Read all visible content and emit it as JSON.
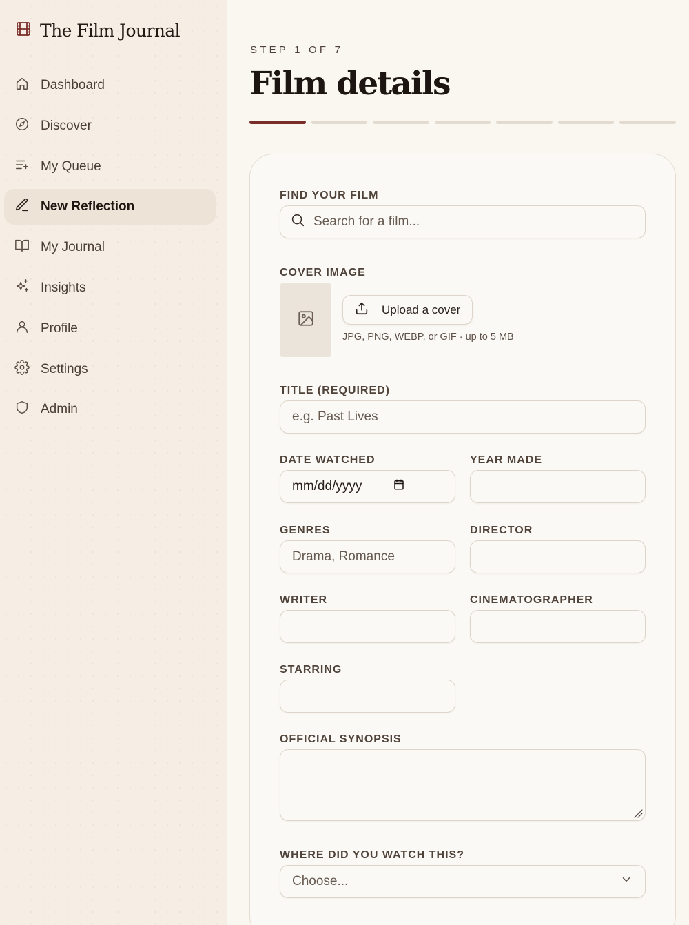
{
  "app": {
    "title": "The Film Journal"
  },
  "sidebar": {
    "items": [
      {
        "label": "Dashboard",
        "icon": "home-icon"
      },
      {
        "label": "Discover",
        "icon": "compass-icon"
      },
      {
        "label": "My Queue",
        "icon": "list-plus-icon"
      },
      {
        "label": "New Reflection",
        "icon": "pen-icon",
        "active": true
      },
      {
        "label": "My Journal",
        "icon": "book-open-icon"
      },
      {
        "label": "Insights",
        "icon": "sparkles-icon"
      },
      {
        "label": "Profile",
        "icon": "user-icon"
      },
      {
        "label": "Settings",
        "icon": "gear-icon"
      },
      {
        "label": "Admin",
        "icon": "shield-icon"
      }
    ]
  },
  "main": {
    "step": "STEP 1 OF 7",
    "title": "Film details",
    "progress": {
      "current": 1,
      "total": 7
    }
  },
  "form": {
    "find": {
      "label": "FIND YOUR FILM",
      "placeholder": "Search for a film..."
    },
    "cover": {
      "label": "COVER IMAGE",
      "button": "Upload a cover",
      "hint": "JPG, PNG, WEBP, or GIF · up to 5 MB"
    },
    "title": {
      "label": "TITLE (REQUIRED)",
      "placeholder": "e.g. Past Lives"
    },
    "date_watched": {
      "label": "DATE WATCHED",
      "placeholder": "mm/dd/yyyy"
    },
    "year_made": {
      "label": "YEAR MADE",
      "value": ""
    },
    "genres": {
      "label": "GENRES",
      "placeholder": "Drama, Romance"
    },
    "director": {
      "label": "DIRECTOR",
      "value": ""
    },
    "writer": {
      "label": "WRITER",
      "value": ""
    },
    "cinematographer": {
      "label": "CINEMATOGRAPHER",
      "value": ""
    },
    "starring": {
      "label": "STARRING",
      "value": ""
    },
    "synopsis": {
      "label": "OFFICIAL SYNOPSIS",
      "value": ""
    },
    "where": {
      "label": "WHERE DID YOU WATCH THIS?",
      "selected": "Choose..."
    }
  },
  "colors": {
    "accent": "#7a2e2a",
    "sidebar_bg": "#f6eee4",
    "page_bg": "#faf7f1"
  }
}
